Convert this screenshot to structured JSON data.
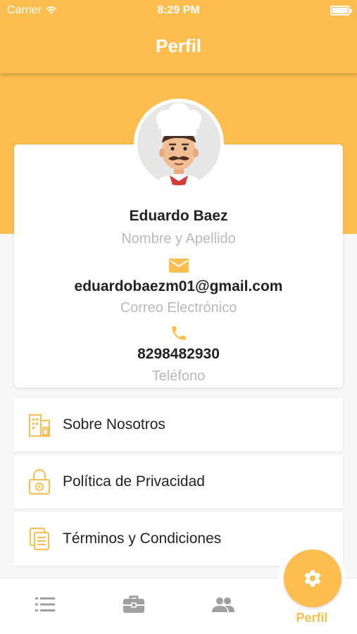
{
  "status_bar": {
    "carrier": "Carrier",
    "time": "8:29 PM"
  },
  "header": {
    "title": "Perfil"
  },
  "profile": {
    "name": "Eduardo Baez",
    "name_label": "Nombre y Apellido",
    "email": "eduardobaezm01@gmail.com",
    "email_label": "Correo Electrónico",
    "phone": "8298482930",
    "phone_label": "Teléfono"
  },
  "menu": {
    "about": "Sobre Nosotros",
    "privacy": "Política de Privacidad",
    "terms": "Términos y Condiciones"
  },
  "tabbar": {
    "profile_label": "Perfil"
  },
  "colors": {
    "accent": "#fdbe4f",
    "text": "#222222",
    "muted": "#b9b9b9"
  }
}
